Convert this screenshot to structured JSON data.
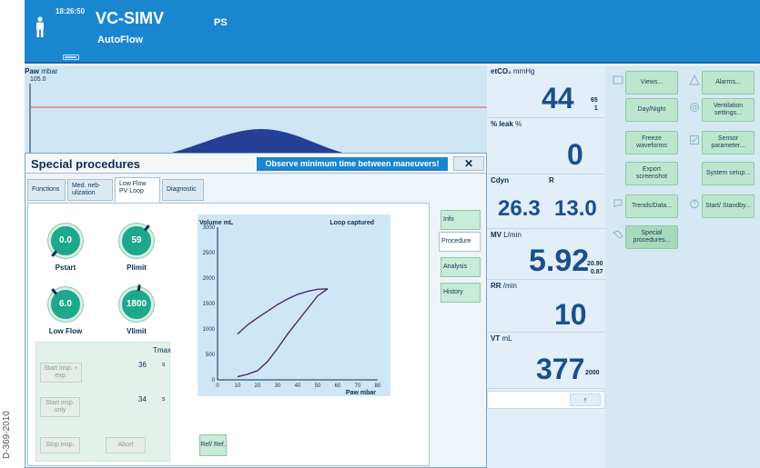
{
  "doc_code": "D-369-2010",
  "header": {
    "time": "18:26:50",
    "mode": "VC-SIMV",
    "sub_mode": "AutoFlow",
    "secondary": "PS"
  },
  "waveform": {
    "label": "Paw",
    "unit": "mbar",
    "scale_max": "105.0"
  },
  "monitor": {
    "etco2": {
      "label": "etCO₂",
      "unit": "mmHg",
      "value": "44",
      "hi": "65",
      "lo": "1"
    },
    "leak": {
      "label": "% leak",
      "unit": "%",
      "value": "0"
    },
    "cdyn": {
      "label": "Cdyn",
      "value": "26.3"
    },
    "r": {
      "label": "R",
      "value": "13.0"
    },
    "mv": {
      "label": "MV",
      "unit": "L/min",
      "value": "5.92",
      "hi": "20.90",
      "lo": "0.87"
    },
    "rr": {
      "label": "RR",
      "unit": "/min",
      "value": "10"
    },
    "vt": {
      "label": "VT",
      "unit": "mL",
      "value": "377",
      "hi": "2000"
    },
    "scroll_arrow": "↑"
  },
  "panel": {
    "views": "Views...",
    "alarms": "Alarms...",
    "day_night": "Day/Night",
    "ventilation_settings": "Ventilation settings...",
    "freeze": "Freeze waveforms",
    "sensor_parameter": "Sensor parameter...",
    "export": "Export screenshot",
    "system_setup": "System setup...",
    "trends": "Trends/Data...",
    "start_standby": "Start/ Standby...",
    "special_procedures": "Special procedures..."
  },
  "dialog": {
    "title": "Special procedures",
    "warning": "Observe minimum time between maneuvers!",
    "close": "✕",
    "tabs": [
      "Functions",
      "Med. neb- ulization",
      "Low Flow PV Loop",
      "Diagnostic"
    ],
    "side_tabs": [
      "Info",
      "Procedure",
      "Analysis",
      "History"
    ],
    "knobs": [
      {
        "value": "0.0",
        "label": "Pstart"
      },
      {
        "value": "59",
        "label": "Plimit"
      },
      {
        "value": "6.0",
        "label": "Low Flow"
      },
      {
        "value": "1800",
        "label": "Vlimit"
      }
    ],
    "tmax_label": "Tmax",
    "row1": {
      "button": "Start insp. + exp.",
      "value": "36",
      "unit": "s"
    },
    "row2": {
      "button": "Start insp. only",
      "value": "34",
      "unit": "s"
    },
    "stop": "Stop insp.",
    "abort": "Abort",
    "ref": "Ref/ Ref."
  },
  "chart_data": {
    "type": "line",
    "title": "Loop captured",
    "ylabel": "Volume mL",
    "xlabel": "Paw mbar",
    "ylim": [
      0,
      3000
    ],
    "xlim": [
      0,
      80
    ],
    "yticks": [
      "3000",
      "2500",
      "2000",
      "1500",
      "1000",
      "500",
      "0"
    ],
    "xticks": [
      "0",
      "10",
      "20",
      "30",
      "40",
      "50",
      "60",
      "70",
      "80"
    ],
    "series": [
      {
        "x": [
          10,
          15,
          20,
          25,
          30,
          35,
          40,
          45,
          50,
          55
        ],
        "y": [
          60,
          110,
          180,
          360,
          620,
          900,
          1150,
          1400,
          1650,
          1790
        ]
      },
      {
        "x": [
          55,
          50,
          45,
          40,
          35,
          30,
          25,
          20,
          15,
          10
        ],
        "y": [
          1790,
          1780,
          1740,
          1680,
          1590,
          1480,
          1350,
          1220,
          1080,
          900
        ]
      }
    ]
  }
}
